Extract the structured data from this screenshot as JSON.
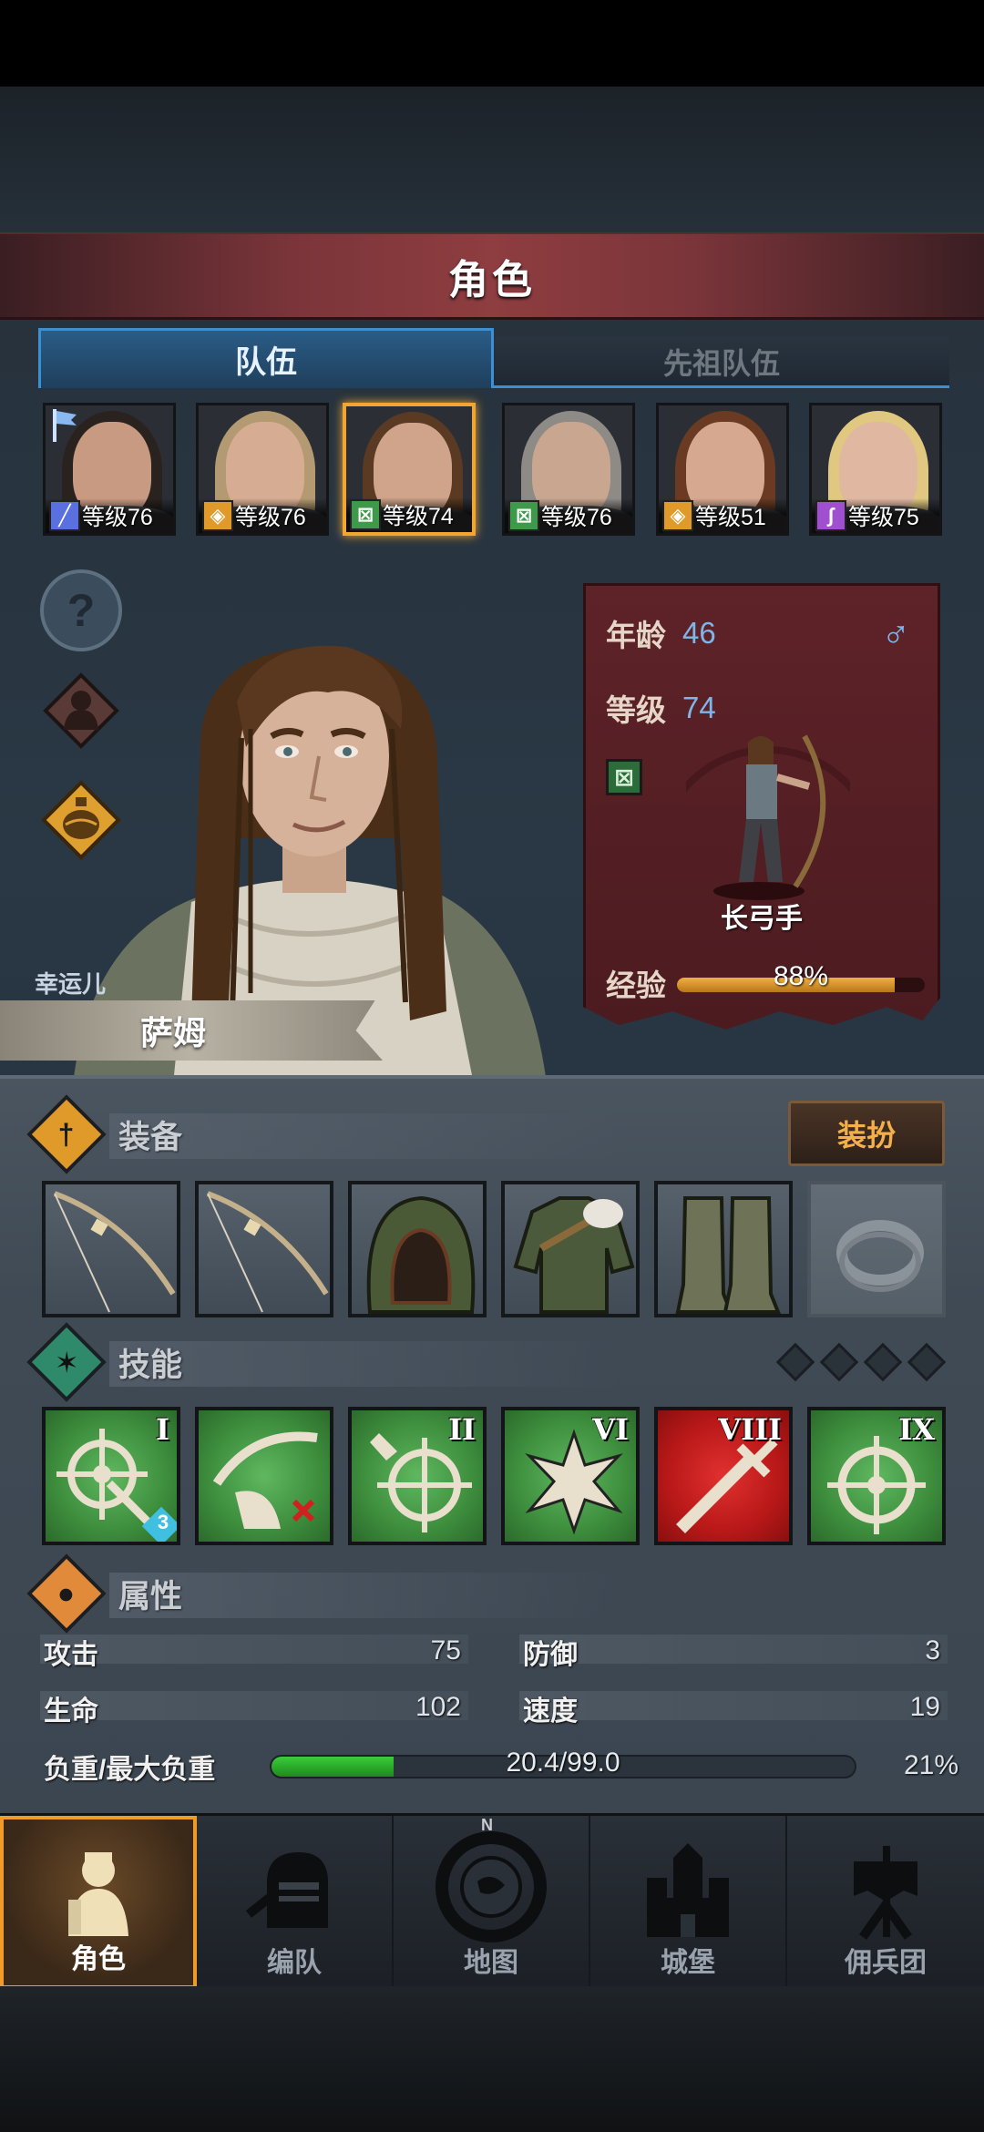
{
  "header": {
    "title": "角色"
  },
  "tabs": {
    "active": "队伍",
    "inactive": "先祖队伍"
  },
  "party": [
    {
      "level_text": "等级76",
      "class_color": "#5a6fe0",
      "class_glyph": "╱",
      "skin": "#c99a82",
      "hair": "#2a221e"
    },
    {
      "level_text": "等级76",
      "class_color": "#e09a2a",
      "class_glyph": "◈",
      "skin": "#d6ad92",
      "hair": "#b49a72"
    },
    {
      "level_text": "等级74",
      "class_color": "#3e9a4a",
      "class_glyph": "⊠",
      "skin": "#d0a48a",
      "hair": "#5a3a22"
    },
    {
      "level_text": "等级76",
      "class_color": "#3e9a4a",
      "class_glyph": "⊠",
      "skin": "#c8a690",
      "hair": "#8e8a86"
    },
    {
      "level_text": "等级51",
      "class_color": "#e09a2a",
      "class_glyph": "◈",
      "skin": "#d6a890",
      "hair": "#6a3a22"
    },
    {
      "level_text": "等级75",
      "class_color": "#a04fd0",
      "class_glyph": "∫",
      "skin": "#e0b8a2",
      "hair": "#e0c880"
    }
  ],
  "character": {
    "age_label": "年龄",
    "age": "46",
    "level_label": "等级",
    "level": "74",
    "gender_symbol": "♂",
    "class_name": "长弓手",
    "exp_label": "经验",
    "exp_text": "88%",
    "exp_fraction": 0.88,
    "title": "幸运儿",
    "name": "萨姆"
  },
  "sections": {
    "equipment": "装备",
    "dress_button": "装扮",
    "skills": "技能",
    "attributes": "属性"
  },
  "skills": [
    {
      "rank": "I",
      "badge": "3"
    },
    {
      "rank": ""
    },
    {
      "rank": "II"
    },
    {
      "rank": "VI"
    },
    {
      "rank": "VIII"
    },
    {
      "rank": "IX"
    }
  ],
  "attributes": {
    "attack_label": "攻击",
    "attack": "75",
    "defense_label": "防御",
    "defense": "3",
    "hp_label": "生命",
    "hp": "102",
    "speed_label": "速度",
    "speed": "19",
    "load_label": "负重/最大负重",
    "load_text": "20.4/99.0",
    "load_percent": "21%",
    "load_fraction": 0.21
  },
  "nav": [
    {
      "label": "角色",
      "compass_n": ""
    },
    {
      "label": "编队"
    },
    {
      "label": "地图",
      "compass_n": "N"
    },
    {
      "label": "城堡"
    },
    {
      "label": "佣兵团"
    }
  ]
}
